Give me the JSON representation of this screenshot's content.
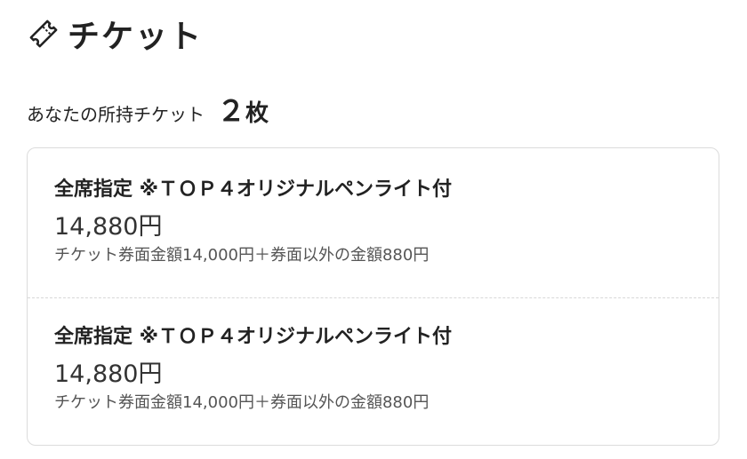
{
  "header": {
    "icon": "ticket-icon",
    "title": "チケット"
  },
  "owned": {
    "label": "あなたの所持チケット",
    "count": "２",
    "unit": "枚"
  },
  "tickets": [
    {
      "name": "全席指定 ※ＴＯＰ４オリジナルペンライト付",
      "price": "14,880円",
      "breakdown": "チケット券面金額14,000円＋券面以外の金額880円"
    },
    {
      "name": "全席指定 ※ＴＯＰ４オリジナルペンライト付",
      "price": "14,880円",
      "breakdown": "チケット券面金額14,000円＋券面以外の金額880円"
    }
  ],
  "colors": {
    "text": "#222222",
    "border": "#dcdcdc",
    "subtext": "#555555"
  }
}
